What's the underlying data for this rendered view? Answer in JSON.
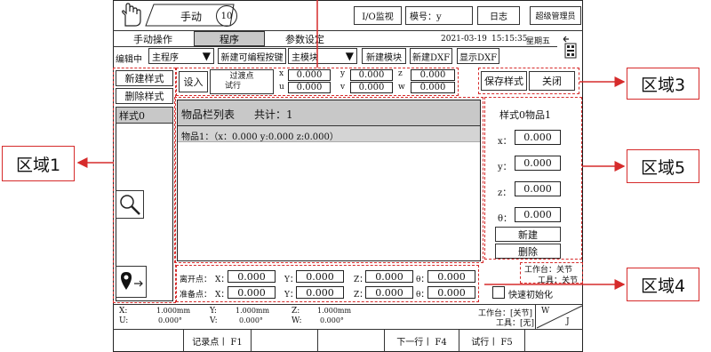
{
  "header": {
    "mode_label": "手动",
    "speed_value": "10",
    "io_monitor": "I/O监视",
    "model_label": "模号：y",
    "log_button": "日志",
    "user_button": "超级管理员"
  },
  "tabs": [
    "手动操作",
    "程序",
    "参数设定"
  ],
  "datetime": {
    "date": "2021-03-19",
    "time": "15:15:35",
    "weekday": "星期五"
  },
  "toolbar": {
    "edit_label": "编辑中",
    "program_select": "主程序",
    "new_key_button": "新建可编程按键",
    "module_select": "主模块",
    "new_module_button": "新建模块",
    "new_dxf_button": "新建DXF",
    "show_dxf_button": "显示DXF"
  },
  "styles_panel": {
    "new_style": "新建样式",
    "delete_style": "删除样式",
    "items": [
      "样式0"
    ]
  },
  "coords_bar": {
    "set_in": "设入",
    "transition_point": "过渡点",
    "trial_run": "试行",
    "x_label": "x",
    "x_value": "0.000",
    "u_label": "u",
    "u_value": "0.000",
    "y_label": "y",
    "y_value": "0.000",
    "v_label": "v",
    "v_value": "0.000",
    "z_label": "z",
    "z_value": "0.000",
    "w_label": "w",
    "w_value": "0.000"
  },
  "region3": {
    "save_style": "保存样式",
    "close": "关闭"
  },
  "item_list": {
    "title": "物品栏列表",
    "count_label": "共计：1",
    "items": [
      "物品1：（x：0.000 y:0.000 z:0.000）"
    ]
  },
  "region5": {
    "title": "样式0物品1",
    "x_label": "x：",
    "x_value": "0.000",
    "y_label": "y：",
    "y_value": "0.000",
    "z_label": "z：",
    "z_value": "0.000",
    "theta_label": "θ：",
    "theta_value": "0.000",
    "new_button": "新建",
    "delete_button": "删除"
  },
  "points": {
    "leave_label": "离开点：",
    "prep_label": "准备点：",
    "x_label": "X：",
    "y_label": "Y：",
    "z_label": "Z：",
    "t_label": "θ：",
    "leave": [
      "0.000",
      "0.000",
      "0.000",
      "0.000"
    ],
    "prep": [
      "0.000",
      "0.000",
      "0.000",
      "0.000"
    ]
  },
  "region4": {
    "table_status": "工作台：关节",
    "tool_status": "工具：关节",
    "fast_init": "快速初始化"
  },
  "status_bar": {
    "x_label": "X:",
    "x_value": "1.000mm",
    "y_label": "Y:",
    "y_value": "1.000mm",
    "z_label": "Z:",
    "z_value": "1.000mm",
    "u_label": "U:",
    "u_value": "0.000°",
    "v_label": "V:",
    "v_value": "0.000°",
    "w_label": "W:",
    "w_value": "0.000°",
    "table": "工作台：[关节]",
    "tool": "工具：[无]",
    "corner_w": "W",
    "corner_j": "J"
  },
  "func_keys": {
    "f1": "记录点丨 F1",
    "f4": "下一行丨  F4",
    "f5": "试行丨  F5"
  },
  "callouts": {
    "region1": "区域1",
    "region3": "区域3",
    "region4": "区域4",
    "region5": "区域5"
  },
  "accent": {
    "annotation_red": "#d62b2b",
    "header_gray": "#c8c8c8",
    "list_gray": "#d4d4d4"
  }
}
